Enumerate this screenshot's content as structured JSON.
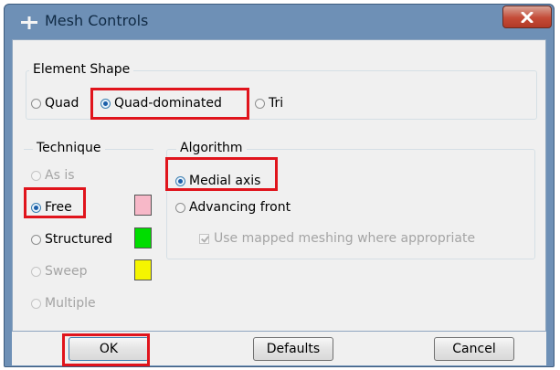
{
  "window": {
    "title": "Mesh Controls",
    "close_icon": "close-icon",
    "app_icon": "mesh-app-icon"
  },
  "element_shape": {
    "legend": "Element Shape",
    "options": [
      {
        "label": "Quad",
        "checked": false
      },
      {
        "label": "Quad-dominated",
        "checked": true
      },
      {
        "label": "Tri",
        "checked": false
      }
    ]
  },
  "technique": {
    "legend": "Technique",
    "options": [
      {
        "label": "As is",
        "checked": false,
        "enabled": false
      },
      {
        "label": "Free",
        "checked": true,
        "enabled": true,
        "swatch": "#f7b8c8"
      },
      {
        "label": "Structured",
        "checked": false,
        "enabled": true,
        "swatch": "#00dd00"
      },
      {
        "label": "Sweep",
        "checked": false,
        "enabled": false,
        "swatch": "#f5f500"
      },
      {
        "label": "Multiple",
        "checked": false,
        "enabled": false
      }
    ]
  },
  "algorithm": {
    "legend": "Algorithm",
    "options": [
      {
        "label": "Medial axis",
        "checked": true
      },
      {
        "label": "Advancing front",
        "checked": false
      }
    ],
    "mapped_meshing": {
      "label": "Use mapped meshing where appropriate",
      "checked": true,
      "enabled": false
    }
  },
  "buttons": {
    "ok": "OK",
    "defaults": "Defaults",
    "cancel": "Cancel"
  },
  "highlight_color": "#e0141c"
}
